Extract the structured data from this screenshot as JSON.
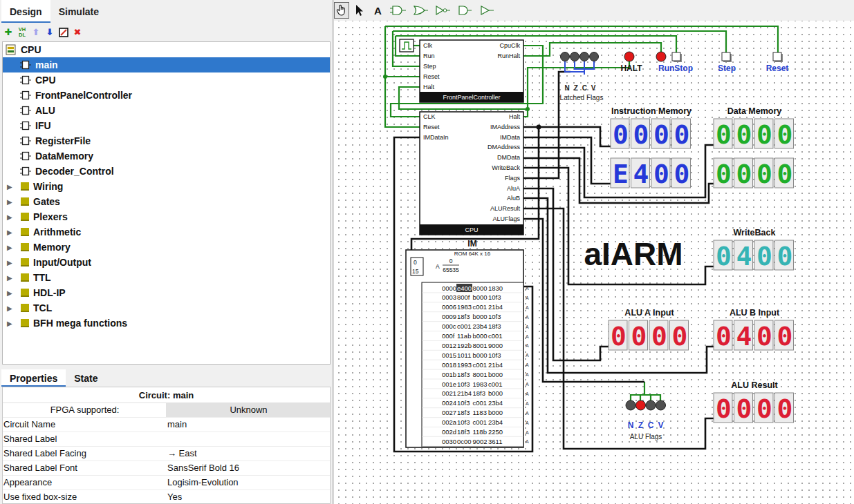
{
  "leftTabs": [
    {
      "label": "Design",
      "selected": true
    },
    {
      "label": "Simulate",
      "selected": false
    }
  ],
  "treeToolbar": [
    {
      "kind": "add-circuit",
      "lines": [
        "✚"
      ],
      "color": "#1a9a1a"
    },
    {
      "kind": "add-vhdl",
      "lines": [
        "VH",
        "DL"
      ],
      "color": "#1a8a1a"
    },
    {
      "kind": "move-up",
      "lines": [
        "⬆"
      ],
      "color": "#a4a4ec"
    },
    {
      "kind": "move-down",
      "lines": [
        "⬇"
      ],
      "color": "#2244cc"
    },
    {
      "kind": "edit-appearance",
      "lines": [],
      "color": "#000000"
    },
    {
      "kind": "remove",
      "lines": [
        "✖"
      ],
      "color": "#e02020"
    }
  ],
  "tree": {
    "project": {
      "label": "CPU",
      "expanded": true
    },
    "toggleGlyph": "▶",
    "circuits": [
      {
        "label": "main",
        "selected": true
      },
      {
        "label": "CPU",
        "selected": false
      },
      {
        "label": "FrontPanelController",
        "selected": false
      },
      {
        "label": "ALU",
        "selected": false
      },
      {
        "label": "IFU",
        "selected": false
      },
      {
        "label": "RegisterFile",
        "selected": false
      },
      {
        "label": "DataMemory",
        "selected": false
      },
      {
        "label": "Decoder_Control",
        "selected": false
      }
    ],
    "libraries": [
      {
        "label": "Wiring",
        "expanded": false
      },
      {
        "label": "Gates",
        "expanded": false
      },
      {
        "label": "Plexers",
        "expanded": false
      },
      {
        "label": "Arithmetic",
        "expanded": false
      },
      {
        "label": "Memory",
        "expanded": false
      },
      {
        "label": "Input/Output",
        "expanded": false
      },
      {
        "label": "TTL",
        "expanded": false
      },
      {
        "label": "HDL-IP",
        "expanded": false
      },
      {
        "label": "TCL",
        "expanded": false
      },
      {
        "label": "BFH mega functions",
        "expanded": false
      }
    ]
  },
  "propertiesTabs": [
    {
      "label": "Properties",
      "selected": true
    },
    {
      "label": "State",
      "selected": false
    }
  ],
  "properties": {
    "header": "Circuit: main",
    "rows": [
      {
        "key": "FPGA supported:",
        "value": "Unknown",
        "kind": "info"
      },
      {
        "key": "Circuit Name",
        "value": "main",
        "kind": "field"
      },
      {
        "key": "Shared Label",
        "value": "",
        "kind": "field"
      },
      {
        "key": "Shared Label Facing",
        "value": "→ East",
        "kind": "field"
      },
      {
        "key": "Shared Label Font",
        "value": "SansSerif Bold 16",
        "kind": "field"
      },
      {
        "key": "Appearance",
        "value": "Logisim-Evolution",
        "kind": "field"
      },
      {
        "key": "Use fixed box-size",
        "value": "Yes",
        "kind": "field"
      }
    ]
  },
  "canvasTools": [
    {
      "kind": "poke",
      "selected": true
    },
    {
      "kind": "select",
      "selected": false
    },
    {
      "kind": "text",
      "label": "A",
      "selected": false
    },
    {
      "kind": "and-gate",
      "selected": false
    },
    {
      "kind": "or-gate",
      "selected": false
    },
    {
      "kind": "not-gate",
      "selected": false
    },
    {
      "kind": "buffer",
      "selected": false
    },
    {
      "kind": "tristate",
      "selected": false
    }
  ],
  "canvas": {
    "logo": "aIARM",
    "frontPanel": {
      "name": "FrontPanelController",
      "inputs": [
        "Clk",
        "Run",
        "Step",
        "Reset",
        "Halt"
      ],
      "outputs": [
        "CpuClk",
        "RunHalt"
      ]
    },
    "cpu": {
      "name": "CPU",
      "inputs": [
        "CLK",
        "Reset",
        "IMDataIn"
      ],
      "outputs": [
        "Halt",
        "IMAddress",
        "IMData",
        "DMAddress",
        "DMData",
        "WriteBack",
        "Flags",
        "AluA",
        "AluB",
        "ALUResult",
        "ALUFlags"
      ]
    },
    "latchedFlags": {
      "title": "Latched Flags",
      "flags": [
        {
          "label": "N",
          "on": false
        },
        {
          "label": "Z",
          "on": false
        },
        {
          "label": "C",
          "on": false
        },
        {
          "label": "V",
          "on": false
        }
      ]
    },
    "indicators": [
      {
        "label": "HALT",
        "kind": "led",
        "on": true
      },
      {
        "label": "RunStop",
        "kind": "led-button",
        "on": true
      },
      {
        "label": "Step",
        "kind": "button",
        "on": false
      },
      {
        "label": "Reset",
        "kind": "button",
        "on": false
      }
    ],
    "displays": [
      {
        "title": "Instruction Memory",
        "color": "#2638d8",
        "rows": [
          "0000",
          "E400"
        ]
      },
      {
        "title": "Data Memory",
        "color": "#1fae2a",
        "rows": [
          "0000",
          "0000"
        ]
      },
      {
        "title": "WriteBack",
        "color": "#36b4b4",
        "rows": [
          "0400"
        ]
      },
      {
        "title": "ALU A Input",
        "color": "#dc1e34",
        "rows": [
          "0000"
        ]
      },
      {
        "title": "ALU B Input",
        "color": "#dc1e34",
        "rows": [
          "0400"
        ]
      },
      {
        "title": "ALU Result",
        "color": "#dc1e34",
        "rows": [
          "0000"
        ]
      }
    ],
    "aluFlags": {
      "title": "ALU Flags",
      "flags": [
        {
          "label": "N",
          "on": false
        },
        {
          "label": "Z",
          "on": true
        },
        {
          "label": "C",
          "on": false
        },
        {
          "label": "V",
          "on": false
        }
      ]
    },
    "rom": {
      "label": "IM",
      "type": "ROM 64K x 16",
      "addrLow": "0",
      "addrHigh": "15",
      "addrLabel": "A",
      "min": "0",
      "max": "65535",
      "pin": "A",
      "rows": [
        {
          "addr": "0000",
          "cells": [
            {
              "text": "e400",
              "selected": true
            },
            {
              "text": "8000",
              "selected": false
            },
            {
              "text": "1830",
              "selected": false
            }
          ]
        },
        {
          "addr": "0003",
          "cells": [
            {
              "text": "800f",
              "selected": false
            },
            {
              "text": "b000",
              "selected": false
            },
            {
              "text": "10f3",
              "selected": false
            }
          ]
        },
        {
          "addr": "0006",
          "cells": [
            {
              "text": "1983",
              "selected": false
            },
            {
              "text": "c001",
              "selected": false
            },
            {
              "text": "21b4",
              "selected": false
            }
          ]
        },
        {
          "addr": "0009",
          "cells": [
            {
              "text": "18f3",
              "selected": false
            },
            {
              "text": "b000",
              "selected": false
            },
            {
              "text": "10f3",
              "selected": false
            }
          ]
        },
        {
          "addr": "000c",
          "cells": [
            {
              "text": "c001",
              "selected": false
            },
            {
              "text": "23b4",
              "selected": false
            },
            {
              "text": "18f3",
              "selected": false
            }
          ]
        },
        {
          "addr": "000f",
          "cells": [
            {
              "text": "11ab",
              "selected": false
            },
            {
              "text": "b000",
              "selected": false
            },
            {
              "text": "c001",
              "selected": false
            }
          ]
        },
        {
          "addr": "0012",
          "cells": [
            {
              "text": "192b",
              "selected": false
            },
            {
              "text": "8001",
              "selected": false
            },
            {
              "text": "9000",
              "selected": false
            }
          ]
        },
        {
          "addr": "0015",
          "cells": [
            {
              "text": "1011",
              "selected": false
            },
            {
              "text": "b000",
              "selected": false
            },
            {
              "text": "10f3",
              "selected": false
            }
          ]
        },
        {
          "addr": "0018",
          "cells": [
            {
              "text": "1993",
              "selected": false
            },
            {
              "text": "c001",
              "selected": false
            },
            {
              "text": "21b4",
              "selected": false
            }
          ]
        },
        {
          "addr": "001b",
          "cells": [
            {
              "text": "18f3",
              "selected": false
            },
            {
              "text": "8001",
              "selected": false
            },
            {
              "text": "b000",
              "selected": false
            }
          ]
        },
        {
          "addr": "001e",
          "cells": [
            {
              "text": "10f3",
              "selected": false
            },
            {
              "text": "1983",
              "selected": false
            },
            {
              "text": "c001",
              "selected": false
            }
          ]
        },
        {
          "addr": "0021",
          "cells": [
            {
              "text": "21b4",
              "selected": false
            },
            {
              "text": "18f3",
              "selected": false
            },
            {
              "text": "b000",
              "selected": false
            }
          ]
        },
        {
          "addr": "0024",
          "cells": [
            {
              "text": "10f3",
              "selected": false
            },
            {
              "text": "c001",
              "selected": false
            },
            {
              "text": "23b4",
              "selected": false
            }
          ]
        },
        {
          "addr": "0027",
          "cells": [
            {
              "text": "18f3",
              "selected": false
            },
            {
              "text": "1183",
              "selected": false
            },
            {
              "text": "b000",
              "selected": false
            }
          ]
        },
        {
          "addr": "002a",
          "cells": [
            {
              "text": "10f3",
              "selected": false
            },
            {
              "text": "c001",
              "selected": false
            },
            {
              "text": "23b4",
              "selected": false
            }
          ]
        },
        {
          "addr": "002d",
          "cells": [
            {
              "text": "18f3",
              "selected": false
            },
            {
              "text": "118b",
              "selected": false
            },
            {
              "text": "2250",
              "selected": false
            }
          ]
        },
        {
          "addr": "0030",
          "cells": [
            {
              "text": "0c00",
              "selected": false
            },
            {
              "text": "9002",
              "selected": false
            },
            {
              "text": "3611",
              "selected": false
            }
          ]
        }
      ]
    }
  }
}
